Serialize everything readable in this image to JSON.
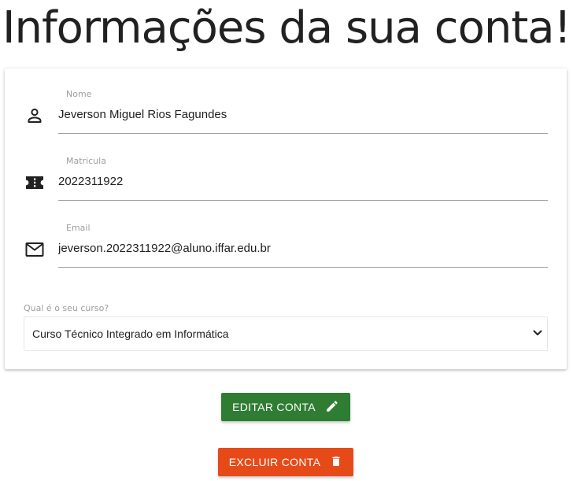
{
  "page": {
    "title": "Informações da sua conta!"
  },
  "form": {
    "nome": {
      "label": "Nome",
      "value": "Jeverson Miguel Rios Fagundes",
      "icon": "person-icon"
    },
    "matricula": {
      "label": "Matricula",
      "value": "2022311922",
      "icon": "ticket-icon"
    },
    "email": {
      "label": "Email",
      "value": "jeverson.2022311922@aluno.iffar.edu.br",
      "icon": "mail-icon"
    },
    "curso": {
      "label": "Qual é o seu curso?",
      "selected": "Curso Técnico Integrado em Informática",
      "icon": "chevron-down-icon"
    }
  },
  "actions": {
    "edit": {
      "label": "EDITAR CONTA",
      "icon": "pencil-icon",
      "color": "#2e7d32"
    },
    "delete": {
      "label": "EXCLUIR CONTA",
      "icon": "trash-icon",
      "color": "#e64a19"
    }
  }
}
